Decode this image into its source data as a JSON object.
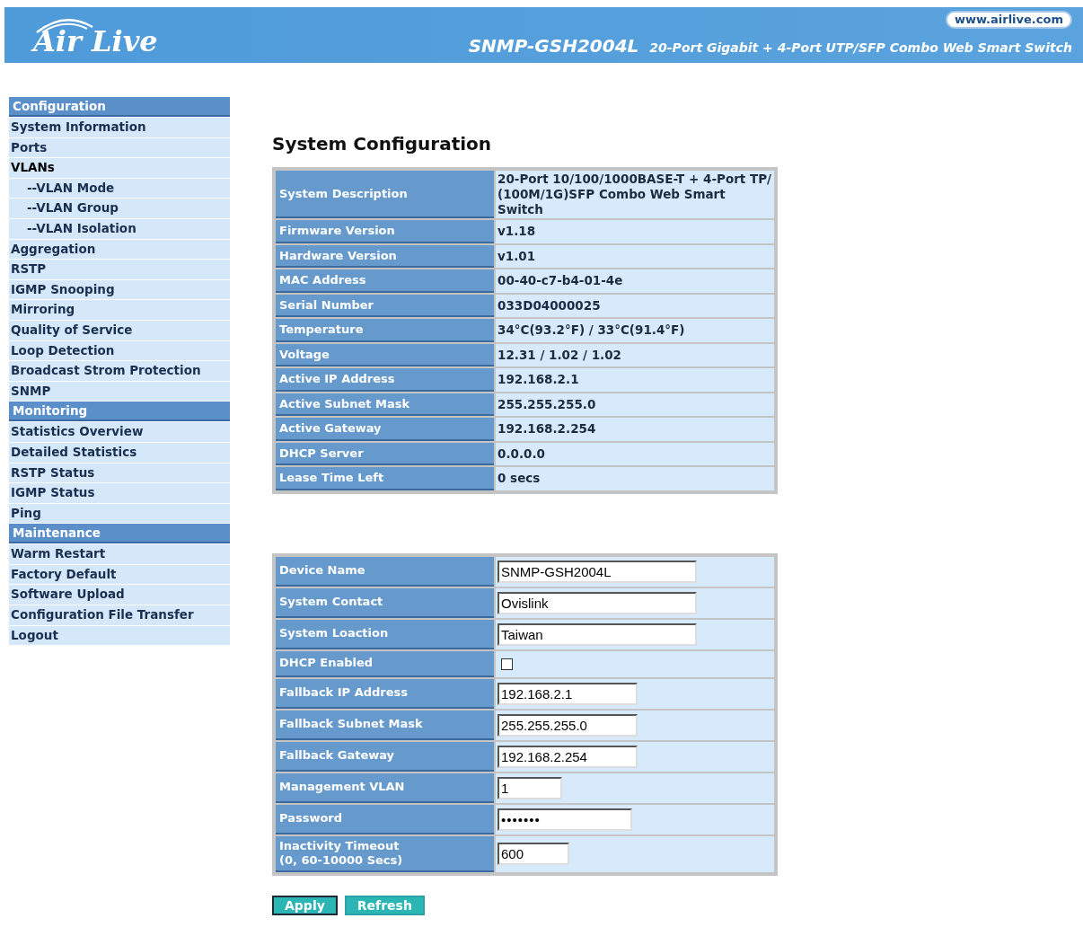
{
  "header": {
    "brand": "Air Live",
    "url": "www.airlive.com",
    "model": "SNMP-GSH2004L",
    "subtitle": "20-Port Gigabit + 4-Port UTP/SFP Combo Web Smart Switch"
  },
  "sidebar": [
    {
      "title": "Configuration",
      "items": [
        {
          "label": "System Information"
        },
        {
          "label": "Ports"
        },
        {
          "label": "VLANs",
          "children": [
            {
              "label": "--VLAN Mode"
            },
            {
              "label": "--VLAN Group"
            },
            {
              "label": "--VLAN Isolation"
            }
          ]
        },
        {
          "label": "Aggregation"
        },
        {
          "label": "RSTP"
        },
        {
          "label": "IGMP Snooping"
        },
        {
          "label": "Mirroring"
        },
        {
          "label": "Quality of Service"
        },
        {
          "label": "Loop Detection"
        },
        {
          "label": "Broadcast Strom Protection"
        },
        {
          "label": "SNMP"
        }
      ]
    },
    {
      "title": "Monitoring",
      "items": [
        {
          "label": "Statistics Overview"
        },
        {
          "label": "Detailed Statistics"
        },
        {
          "label": "RSTP Status"
        },
        {
          "label": "IGMP Status"
        },
        {
          "label": "Ping"
        }
      ]
    },
    {
      "title": "Maintenance",
      "items": [
        {
          "label": "Warm Restart"
        },
        {
          "label": "Factory Default"
        },
        {
          "label": "Software Upload"
        },
        {
          "label": "Configuration File Transfer"
        },
        {
          "label": "Logout"
        }
      ]
    }
  ],
  "page_title": "System Configuration",
  "info_table": [
    {
      "label": "System Description",
      "value": "20-Port 10/100/1000BASE-T + 4-Port TP/ (100M/1G)SFP Combo Web Smart Switch"
    },
    {
      "label": "Firmware Version",
      "value": "v1.18"
    },
    {
      "label": "Hardware Version",
      "value": "v1.01"
    },
    {
      "label": "MAC Address",
      "value": "00-40-c7-b4-01-4e"
    },
    {
      "label": "Serial Number",
      "value": "033D04000025"
    },
    {
      "label": "Temperature",
      "value": "34°C(93.2°F) / 33°C(91.4°F)"
    },
    {
      "label": "Voltage",
      "value": "12.31 / 1.02 / 1.02"
    },
    {
      "label": "Active IP Address",
      "value": "192.168.2.1"
    },
    {
      "label": "Active Subnet Mask",
      "value": "255.255.255.0"
    },
    {
      "label": "Active Gateway",
      "value": "192.168.2.254"
    },
    {
      "label": "DHCP Server",
      "value": "0.0.0.0"
    },
    {
      "label": "Lease Time Left",
      "value": "0 secs"
    }
  ],
  "settings_table": [
    {
      "kind": "text",
      "label": "Device Name",
      "value": "SNMP-GSH2004L"
    },
    {
      "kind": "text",
      "label": "System Contact",
      "value": "Ovislink"
    },
    {
      "kind": "text",
      "label": "System Loaction",
      "value": "Taiwan"
    },
    {
      "kind": "checkbox",
      "label": "DHCP Enabled",
      "checked": false
    },
    {
      "kind": "text",
      "label": "Fallback IP Address",
      "value": "192.168.2.1"
    },
    {
      "kind": "text",
      "label": "Fallback Subnet Mask",
      "value": "255.255.255.0"
    },
    {
      "kind": "text",
      "label": "Fallback Gateway",
      "value": "192.168.2.254"
    },
    {
      "kind": "text",
      "label": "Management VLAN",
      "value": "1"
    },
    {
      "kind": "password",
      "label": "Password",
      "value": "•••••••"
    },
    {
      "kind": "text",
      "label": "Inactivity Timeout\n(0, 60-10000 Secs)",
      "value": "600"
    }
  ],
  "buttons": [
    "Apply",
    "Refresh"
  ]
}
